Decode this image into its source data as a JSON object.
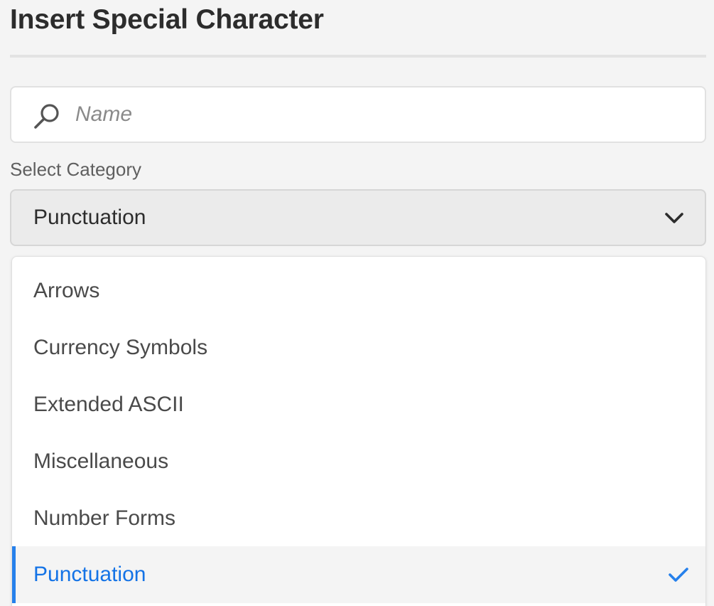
{
  "dialog": {
    "title": "Insert Special Character"
  },
  "search": {
    "placeholder": "Name",
    "value": "",
    "icon": "search-icon"
  },
  "category": {
    "label": "Select Category",
    "selected": "Punctuation",
    "icon": "chevron-down-icon"
  },
  "dropdown": {
    "options": [
      {
        "label": "Arrows",
        "selected": false
      },
      {
        "label": "Currency Symbols",
        "selected": false
      },
      {
        "label": "Extended ASCII",
        "selected": false
      },
      {
        "label": "Miscellaneous",
        "selected": false
      },
      {
        "label": "Number Forms",
        "selected": false
      },
      {
        "label": "Punctuation",
        "selected": true
      }
    ],
    "check_icon": "checkmark-icon"
  },
  "colors": {
    "accent": "#1473e6",
    "selected_bar": "#2680eb",
    "background": "#f4f4f4"
  }
}
